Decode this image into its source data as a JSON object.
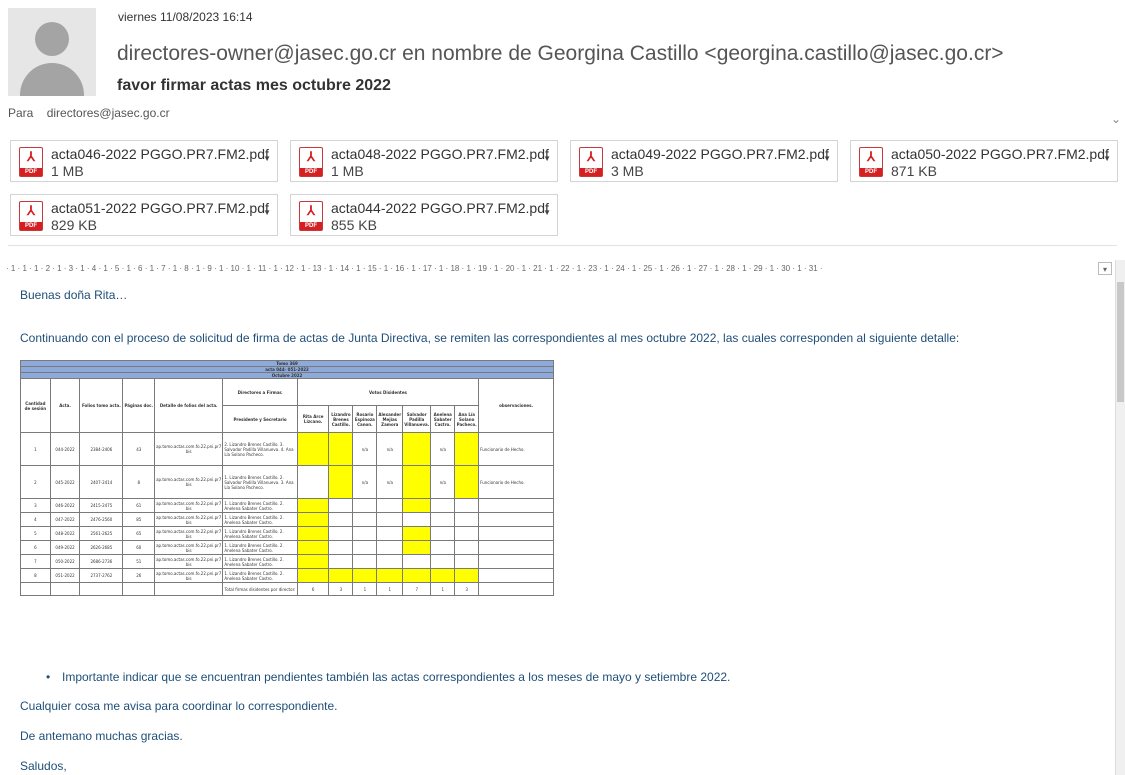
{
  "email": {
    "date": "viernes 11/08/2023 16:14",
    "from": "directores-owner@jasec.go.cr en nombre de Georgina Castillo <georgina.castillo@jasec.go.cr>",
    "subject": "favor firmar actas mes octubre 2022",
    "to_label": "Para",
    "to_value": "directores@jasec.go.cr"
  },
  "attachments": [
    {
      "name": "acta046-2022 PGGO.PR7.FM2.pdf",
      "size": "1 MB"
    },
    {
      "name": "acta048-2022 PGGO.PR7.FM2.pdf",
      "size": "1 MB"
    },
    {
      "name": "acta049-2022 PGGO.PR7.FM2.pdf",
      "size": "3 MB"
    },
    {
      "name": "acta050-2022 PGGO.PR7.FM2.pdf",
      "size": "871 KB"
    },
    {
      "name": "acta051-2022 PGGO.PR7.FM2.pdf",
      "size": "829 KB"
    },
    {
      "name": "acta044-2022 PGGO.PR7.FM2.pdf",
      "size": "855 KB"
    }
  ],
  "attachment_icon": "pdf-icon",
  "ruler_text": "· 1 · 1 · 1 · 2 · 1 · 3 · 1 · 4 · 1 · 5 · 1 · 6 · 1 · 7 · 1 · 8 · 1 · 9 · 1 · 10 · 1 · 11 · 1 · 12 · 1 · 13 · 1 · 14 · 1 · 15 · 1 · 16 · 1 · 17 · 1 · 18 · 1 · 19 · 1 · 20 · 1 · 21 · 1 · 22 · 1 · 23 · 1 · 24 · 1 · 25 · 1 · 26 · 1 · 27 · 1 · 28 · 1 · 29 · 1 · 30 · 1 · 31 ·",
  "body": {
    "greeting": "Buenas doña Rita…",
    "intro": "Continuando con el proceso de solicitud de firma de actas de Junta Directiva, se remiten las correspondientes al mes octubre 2022, las cuales corresponden al siguiente detalle:",
    "bullet": "Importante indicar que se encuentran pendientes también las actas correspondientes a los meses de mayo y setiembre 2022.",
    "line1": "Cualquier cosa me avisa para coordinar lo correspondiente.",
    "line2": "De antemano muchas gracias.",
    "closing": "Saludos,"
  },
  "table": {
    "title1": "Tomo 369",
    "title2": "acta 044- 051-2022",
    "title3": "Octubre 2022",
    "headers": {
      "cantidad": "Cantidad de sesión",
      "acta": "Acta.",
      "folios": "Folios tomo acta.",
      "paginas": "Páginas doc.",
      "detalle": "Detalle de folios del acta.",
      "directores": "Directores a Firmar.",
      "presidente": "Presidente y Secretario",
      "votos": "Votos Disidentes",
      "observaciones": "observaciones.",
      "voters": [
        "Rita Arce Lizcano.",
        "Lizandro Brenes Castillo.",
        "Rosario Espinoza Canon.",
        "Alexander Mejías Zamora",
        "Salvador Padilla Villanueva.",
        "Anelena Sabater Castro.",
        "Ana Lía Solano Pacheco."
      ]
    },
    "rows": [
      {
        "n": "1",
        "acta": "044-2022",
        "folios": "2384-2406",
        "pag": "43",
        "detalle": "ap.tomo.actas.com.fo.22.pni.pr7 bis",
        "dir": "2. Lizandro Brenes Castillo. 3. Salvador Padilla Villanueva. 4. Ana Lía Solano Pacheco.",
        "v": [
          "",
          "",
          "n/a",
          "n/a",
          "",
          "n/a",
          ""
        ],
        "obs": "Funcionario de Hecho."
      },
      {
        "n": "2",
        "acta": "045-2022",
        "folios": "2407-2414",
        "pag": "8",
        "detalle": "ap.tomo.actas.com.fo.22.pni.pr7 bis",
        "dir": "1. Lizandro Brenes Castillo. 2. Salvador Padilla Villanueva. 3. Ana Lía Solano Pacheco.",
        "v": [
          "",
          "",
          "n/a",
          "n/a",
          "",
          "n/a",
          ""
        ],
        "obs": "Funcionario de Hecho."
      },
      {
        "n": "3",
        "acta": "046-2022",
        "folios": "2415-2475",
        "pag": "61",
        "detalle": "ap.tomo.actas.com.fo.22.pni.pr7 bis",
        "dir": "1. Lizandro Brenes Castillo. 2. Anelena Sabater Castro.",
        "v": [
          "",
          "",
          "",
          "",
          "",
          "",
          ""
        ],
        "obs": ""
      },
      {
        "n": "4",
        "acta": "047-2022",
        "folios": "2476-2560",
        "pag": "85",
        "detalle": "ap.tomo.actas.com.fo.22.pni.pr7 bis",
        "dir": "1. Lizandro Brenes Castillo. 2. Anelena Sabater Castro.",
        "v": [
          "",
          "",
          "",
          "",
          "",
          "",
          ""
        ],
        "obs": ""
      },
      {
        "n": "5",
        "acta": "048-2022",
        "folios": "2561-2625",
        "pag": "65",
        "detalle": "ap.tomo.actas.com.fo.22.pni.pr7 bis",
        "dir": "1. Lizandro Brenes Castillo. 2. Anelena Sabater Castro.",
        "v": [
          "",
          "",
          "",
          "",
          "",
          "",
          ""
        ],
        "obs": ""
      },
      {
        "n": "6",
        "acta": "049-2022",
        "folios": "2626-2685",
        "pag": "60",
        "detalle": "ap.tomo.actas.com.fo.22.pni.pr7 bis",
        "dir": "1. Lizandro Brenes Castillo. 2. Anelena Sabater Castro.",
        "v": [
          "",
          "",
          "",
          "",
          "",
          "",
          ""
        ],
        "obs": ""
      },
      {
        "n": "7",
        "acta": "050-2022",
        "folios": "2686-2736",
        "pag": "51",
        "detalle": "ap.tomo.actas.com.fo.22.pni.pr7 bis",
        "dir": "1. Lizandro Brenes Castillo. 2. Anelena Sabater Castro.",
        "v": [
          "",
          "",
          "",
          "",
          "",
          "",
          ""
        ],
        "obs": ""
      },
      {
        "n": "8",
        "acta": "051-2022",
        "folios": "2737-2762",
        "pag": "26",
        "detalle": "ap.tomo.actas.com.fo.22.pni.pr7 bis",
        "dir": "1. Lizandro Brenes Castillo. 2. Anelena Sabater Castro.",
        "v": [
          "",
          "",
          "",
          "",
          "",
          "",
          ""
        ],
        "obs": ""
      }
    ],
    "highlight": [
      [
        1,
        1,
        0,
        0,
        1,
        0,
        1
      ],
      [
        0,
        1,
        0,
        0,
        1,
        0,
        1
      ],
      [
        1,
        0,
        0,
        0,
        1,
        0,
        0
      ],
      [
        1,
        0,
        0,
        0,
        0,
        0,
        0
      ],
      [
        1,
        0,
        0,
        0,
        1,
        0,
        0
      ],
      [
        1,
        0,
        0,
        0,
        1,
        0,
        0
      ],
      [
        1,
        0,
        0,
        0,
        0,
        0,
        0
      ],
      [
        1,
        1,
        1,
        1,
        1,
        1,
        1
      ]
    ],
    "total_label": "Total firmas disidentes por director:",
    "totals": [
      "6",
      "3",
      "1",
      "1",
      "7",
      "1",
      "3"
    ],
    "highlight_color": "#ffff00",
    "header_color": "#8eaadb"
  }
}
